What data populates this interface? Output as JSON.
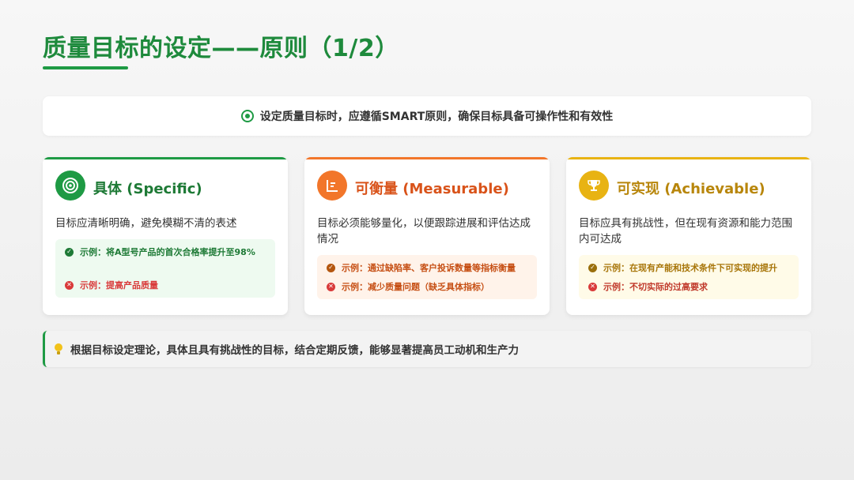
{
  "title": "质量目标的设定——原则（1/2）",
  "intro": {
    "text": "设定质量目标时，应遵循SMART原则，确保目标具备可操作性和有效性",
    "icon": "target-icon"
  },
  "cards": [
    {
      "title": "具体 (Specific)",
      "icon": "target-icon",
      "accent": "#1e9a44",
      "description": "目标应清晰明确，避免模糊不清的表述",
      "examples": [
        {
          "type": "good",
          "text": "示例：将A型号产品的首次合格率提升至98%"
        },
        {
          "type": "bad",
          "text": "示例：提高产品质量"
        }
      ]
    },
    {
      "title": "可衡量 (Measurable)",
      "icon": "chart-list-icon",
      "accent": "#f2762a",
      "description": "目标必须能够量化，以便跟踪进展和评估达成情况",
      "examples": [
        {
          "type": "good",
          "text": "示例：通过缺陷率、客户投诉数量等指标衡量"
        },
        {
          "type": "bad",
          "text": "示例：减少质量问题（缺乏具体指标）"
        }
      ]
    },
    {
      "title": "可实现 (Achievable)",
      "icon": "trophy-icon",
      "accent": "#e8b313",
      "description": "目标应具有挑战性，但在现有资源和能力范围内可达成",
      "examples": [
        {
          "type": "good",
          "text": "示例：在现有产能和技术条件下可实现的提升"
        },
        {
          "type": "bad",
          "text": "示例：不切实际的过高要求"
        }
      ]
    }
  ],
  "note": {
    "text": "根据目标设定理论，具体且具有挑战性的目标，结合定期反馈，能够显著提高员工动机和生产力",
    "icon": "lightbulb-icon"
  },
  "colors": {
    "title": "#1e8a3c",
    "green": "#1e9a44",
    "orange": "#f2762a",
    "gold": "#e8b313",
    "bad": "#d93a3a"
  }
}
